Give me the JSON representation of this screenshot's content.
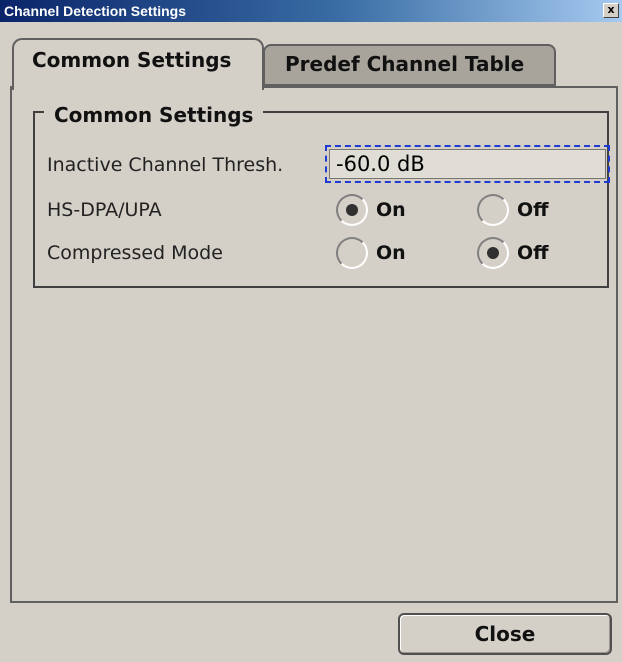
{
  "window": {
    "title": "Channel Detection Settings",
    "close_glyph": "x"
  },
  "tabs": [
    {
      "label": "Common Settings",
      "active": true
    },
    {
      "label": "Predef Channel Table",
      "active": false
    }
  ],
  "group": {
    "legend": "Common Settings",
    "inactive_threshold": {
      "label": "Inactive Channel Thresh.",
      "value": "-60.0 dB"
    },
    "hsdpa": {
      "label": "HS-DPA/UPA",
      "options": [
        {
          "label": "On",
          "selected": true
        },
        {
          "label": "Off",
          "selected": false
        }
      ]
    },
    "compressed_mode": {
      "label": "Compressed Mode",
      "options": [
        {
          "label": "On",
          "selected": false
        },
        {
          "label": "Off",
          "selected": true
        }
      ]
    }
  },
  "footer": {
    "close_label": "Close"
  },
  "colors": {
    "titlebar_start": "#0a246a",
    "titlebar_end": "#a6caf0",
    "background": "#d4d0c8",
    "focus_outline": "#1f3ad1"
  }
}
